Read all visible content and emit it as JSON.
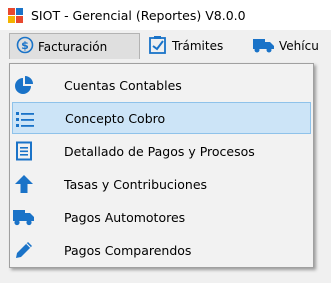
{
  "window": {
    "title": "SIOT - Gerencial (Reportes) V8.0.0"
  },
  "menubar": {
    "items": [
      {
        "label": "Facturación",
        "icon": "dollar-circle-icon",
        "open": true
      },
      {
        "label": "Trámites",
        "icon": "checklist-icon"
      },
      {
        "label": "Vehícu",
        "icon": "truck-icon"
      }
    ]
  },
  "dropdown": {
    "items": [
      {
        "label": "Cuentas Contables",
        "icon": "pie-chart-icon"
      },
      {
        "label": "Concepto Cobro",
        "icon": "bulleted-list-icon",
        "highlighted": true
      },
      {
        "label": "Detallado de Pagos y Procesos",
        "icon": "document-lines-icon"
      },
      {
        "label": "Tasas y Contribuciones",
        "icon": "arrow-up-icon"
      },
      {
        "label": "Pagos Automotores",
        "icon": "truck-icon"
      },
      {
        "label": "Pagos Comparendos",
        "icon": "pencil-icon"
      }
    ]
  },
  "colors": {
    "accent": "#1a73c8",
    "highlight": "#cce4f7"
  }
}
